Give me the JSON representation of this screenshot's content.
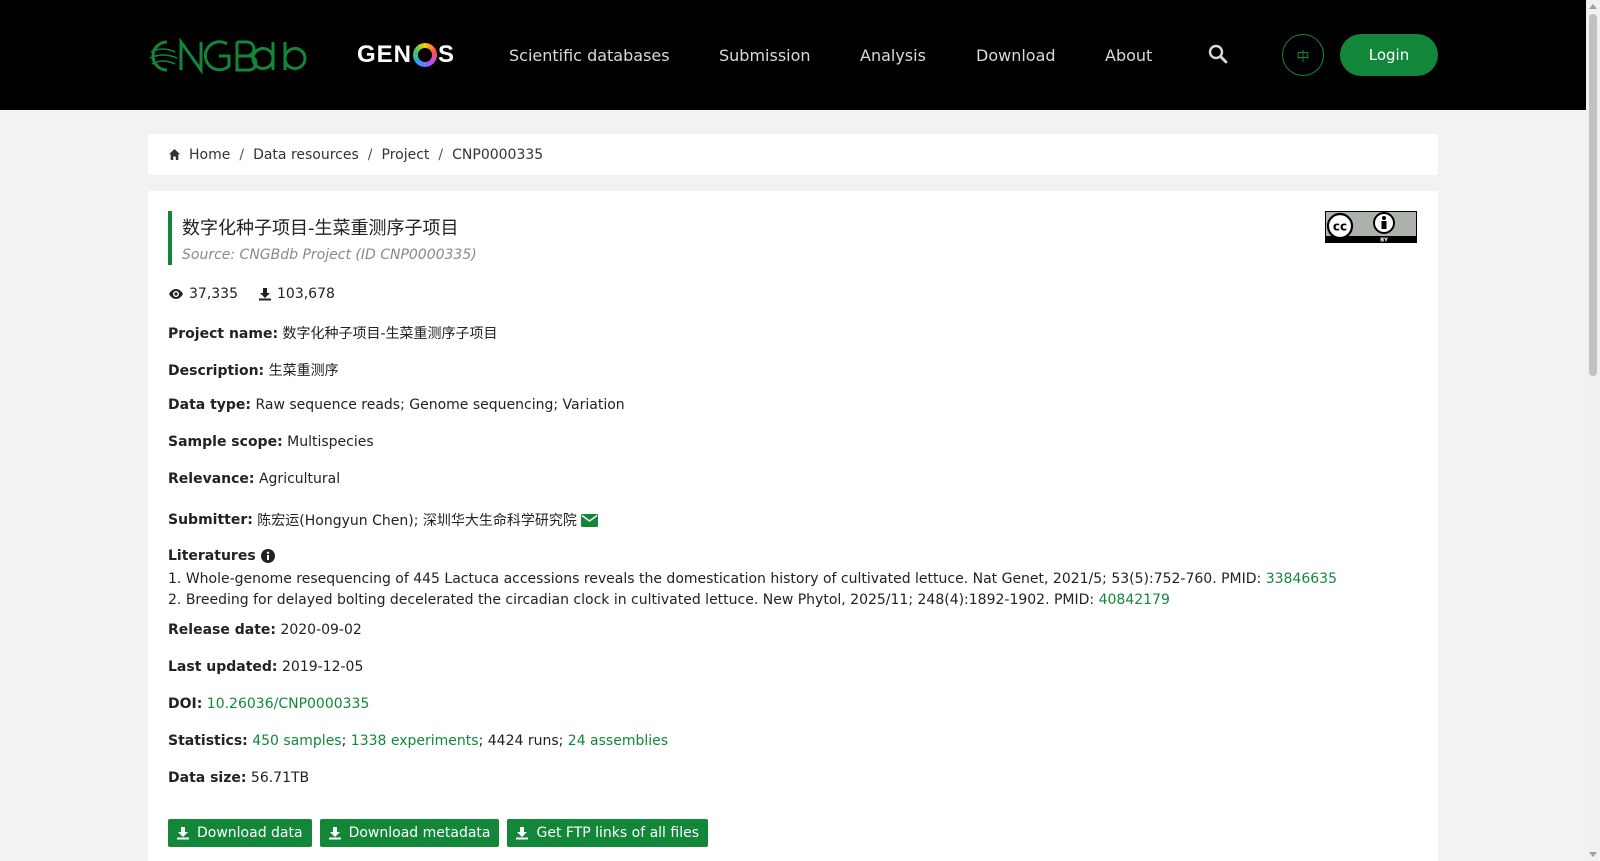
{
  "header": {
    "logo_text": "CNGBdb",
    "genos_text_left": "GEN",
    "genos_text_right": "S",
    "nav": [
      {
        "label": "Scientific databases"
      },
      {
        "label": "Submission"
      },
      {
        "label": "Analysis"
      },
      {
        "label": "Download"
      },
      {
        "label": "About"
      }
    ],
    "lang_label": "中",
    "login_label": "Login",
    "accent": "#12873a"
  },
  "breadcrumb": {
    "items": [
      "Home",
      "Data resources",
      "Project",
      "CNP0000335"
    ]
  },
  "project": {
    "title": "数字化种子项目-生菜重测序子项目",
    "source": "Source: CNGBdb Project (ID CNP0000335)",
    "views": "37,335",
    "downloads": "103,678",
    "fields": {
      "name_label": "Project name:",
      "name": "数字化种子项目-生菜重测序子项目",
      "description_label": "Description:",
      "description": "生菜重测序",
      "data_type_label": "Data type:",
      "data_type": "Raw sequence reads; Genome sequencing; Variation",
      "sample_scope_label": "Sample scope:",
      "sample_scope": "Multispecies",
      "relevance_label": "Relevance:",
      "relevance": "Agricultural",
      "submitter_label": "Submitter:",
      "submitter": "陈宏运(Hongyun Chen); 深圳华大生命科学研究院",
      "literatures_label": "Literatures",
      "release_label": "Release date:",
      "release": "2020-09-02",
      "updated_label": "Last updated:",
      "updated": "2019-12-05",
      "doi_label": "DOI:",
      "doi": "10.26036/CNP0000335",
      "statistics_label": "Statistics:",
      "samples": "450 samples",
      "experiments": "1338 experiments",
      "runs": "4424 runs",
      "assemblies": "24 assemblies",
      "datasize_label": "Data size:",
      "datasize": "56.71TB"
    },
    "literatures": [
      {
        "num": "1.",
        "text": "Whole-genome resequencing of 445 Lactuca accessions reveals the domestication history of cultivated lettuce. Nat Genet, 2021/5; 53(5):752-760. PMID: ",
        "pmid": "33846635"
      },
      {
        "num": "2.",
        "text": "Breeding for delayed bolting decelerated the circadian clock in cultivated lettuce. New Phytol, 2025/11; 248(4):1892-1902. PMID: ",
        "pmid": "40842179"
      }
    ],
    "buttons": {
      "download_data": "Download data",
      "download_metadata": "Download metadata",
      "ftp_links": "Get FTP links of all files"
    }
  }
}
